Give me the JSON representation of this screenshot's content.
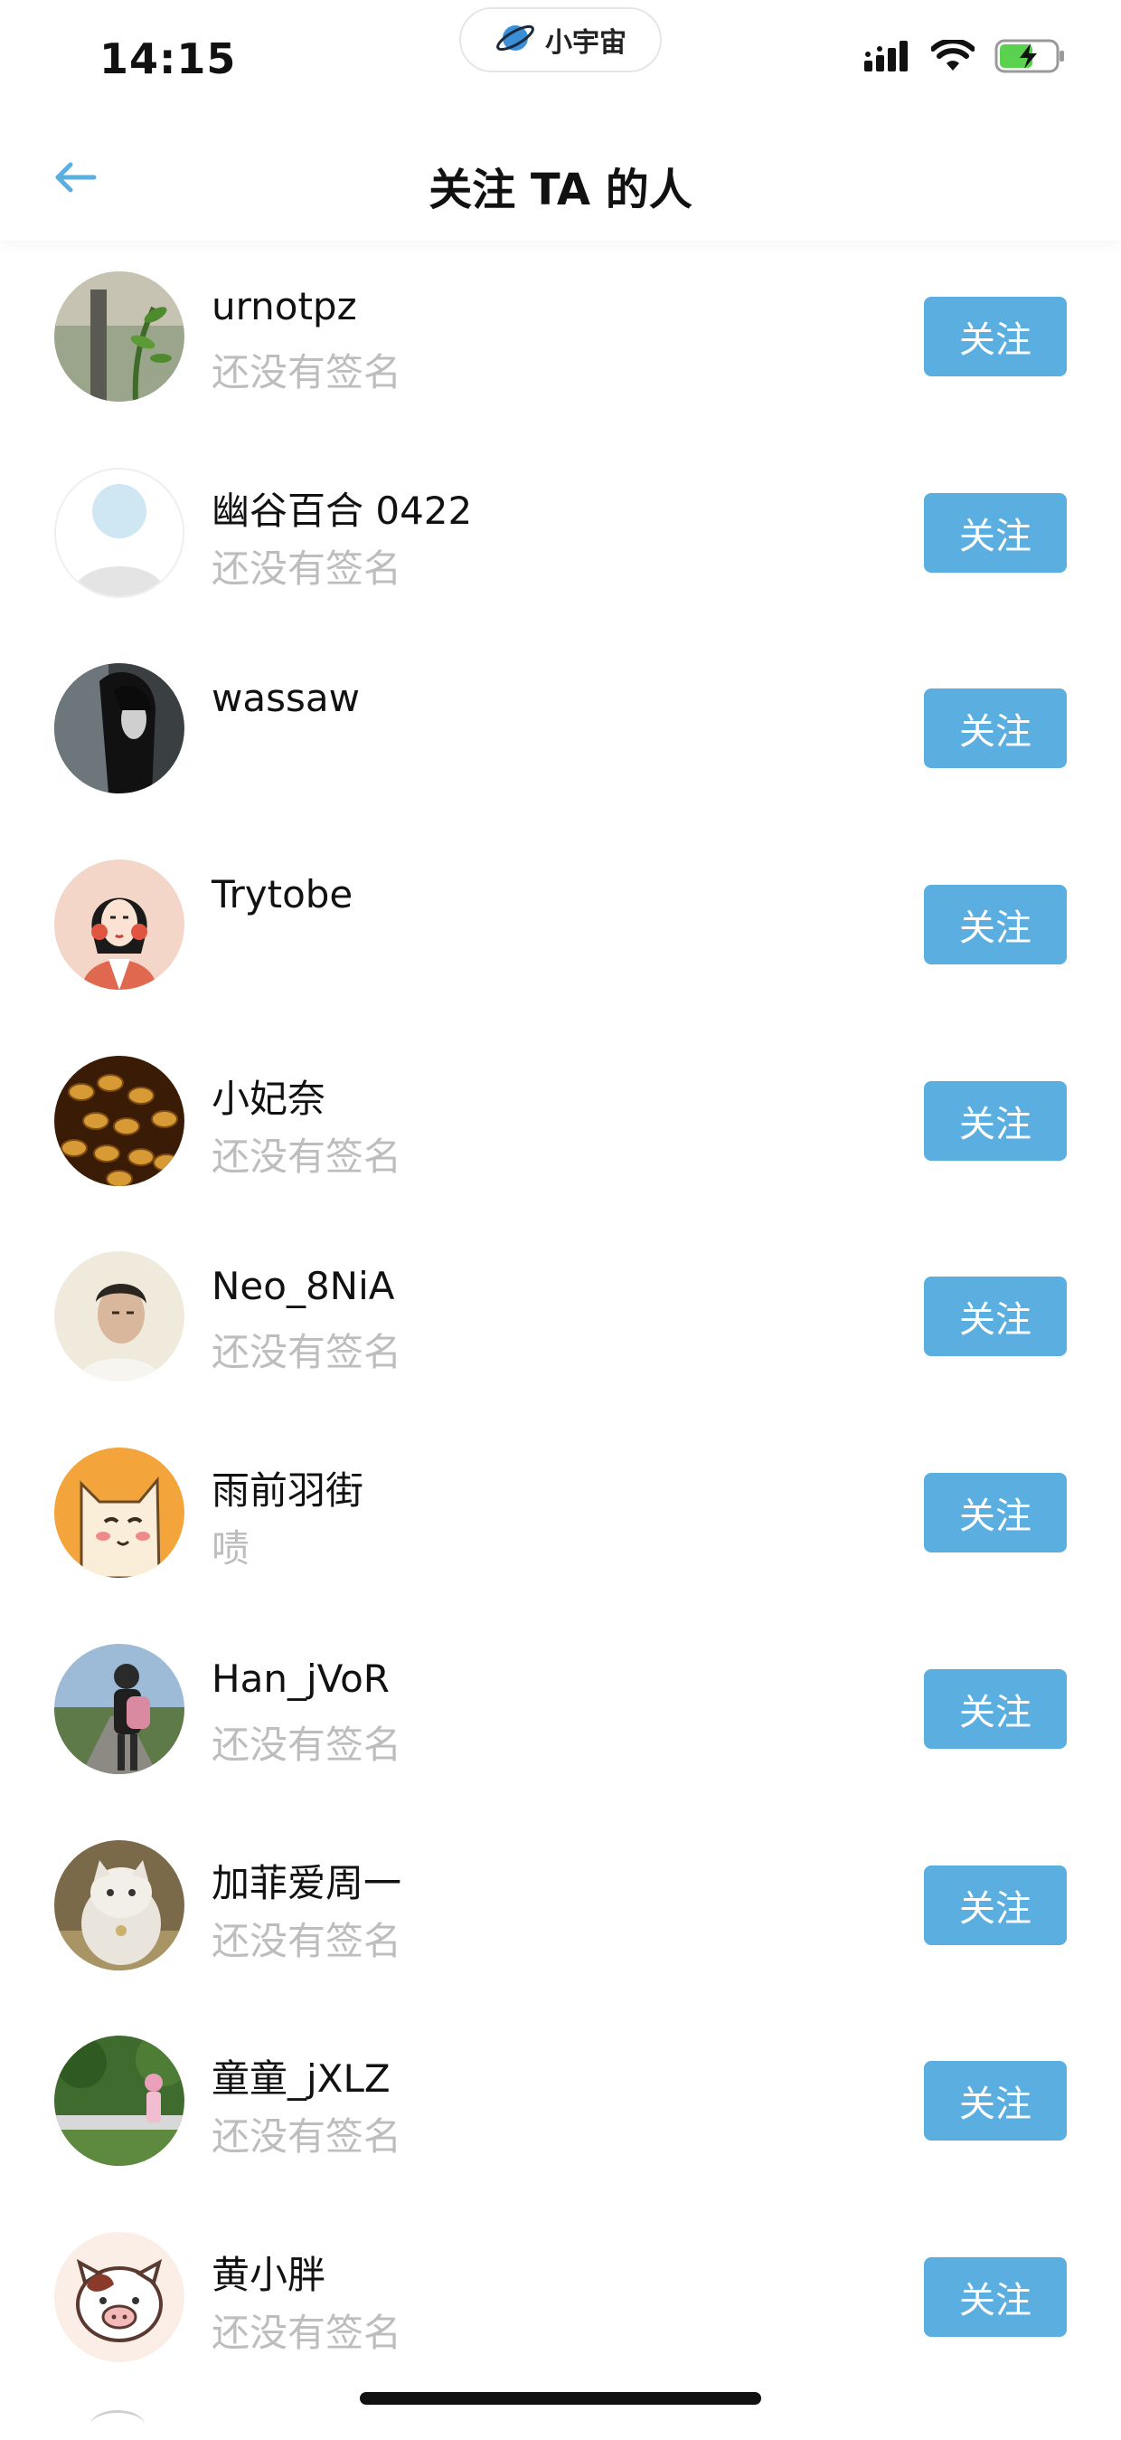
{
  "status_bar": {
    "time": "14:15",
    "app_pill_label": "小宇宙",
    "colors": {
      "battery_fill": "#5ad14f"
    }
  },
  "nav": {
    "title": "关注 TA 的人",
    "back_icon": "arrow-left-icon",
    "accent": "#5aaee0"
  },
  "follow_button_color": "#5aaee0",
  "users": [
    {
      "name": "urnotpz",
      "signature": "还没有签名",
      "button": "关注"
    },
    {
      "name": "幽谷百合 0422",
      "signature": "还没有签名",
      "button": "关注"
    },
    {
      "name": "wassaw",
      "signature": "",
      "button": "关注"
    },
    {
      "name": "Trytobe",
      "signature": "",
      "button": "关注"
    },
    {
      "name": "小妃奈",
      "signature": "还没有签名",
      "button": "关注"
    },
    {
      "name": "Neo_8NiA",
      "signature": "还没有签名",
      "button": "关注"
    },
    {
      "name": "雨前羽街",
      "signature": "啧",
      "button": "关注"
    },
    {
      "name": "Han_jVoR",
      "signature": "还没有签名",
      "button": "关注"
    },
    {
      "name": "加菲爱周一",
      "signature": "还没有签名",
      "button": "关注"
    },
    {
      "name": "童童_jXLZ",
      "signature": "还没有签名",
      "button": "关注"
    },
    {
      "name": "黄小胖",
      "signature": "还没有签名",
      "button": "关注"
    }
  ]
}
